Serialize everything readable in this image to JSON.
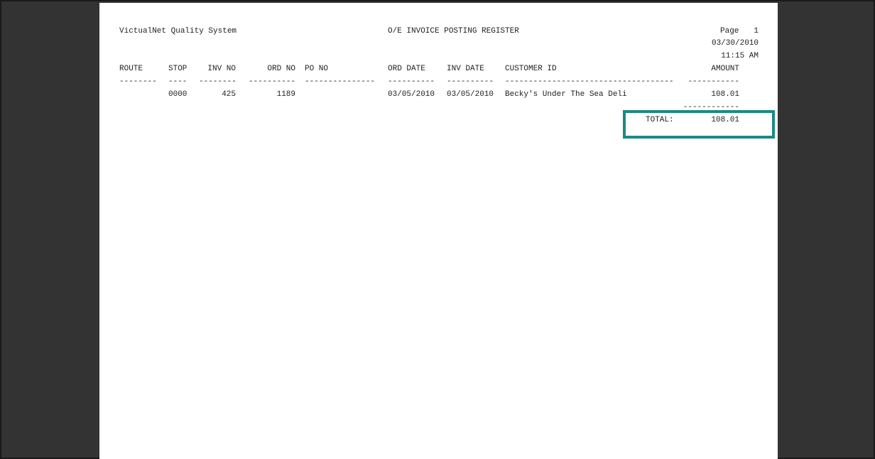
{
  "report": {
    "company": "VictualNet Quality System",
    "title": "O/E INVOICE POSTING REGISTER",
    "page_label": "Page",
    "page_number": "1",
    "date": "03/30/2010",
    "time": "11:15 AM"
  },
  "columns": {
    "route": "ROUTE",
    "stop": "STOP",
    "inv_no": "INV NO",
    "ord_no": "ORD NO",
    "po_no": "PO NO",
    "ord_date": "ORD DATE",
    "inv_date": "INV DATE",
    "customer_id": "CUSTOMER ID",
    "amount": "AMOUNT"
  },
  "separators": {
    "route": "--------",
    "stop": "----",
    "inv_no": "--------",
    "ord_no": "----------",
    "po_no": "---------------",
    "ord_date": "----------",
    "inv_date": "----------",
    "customer_id": "------------------------------------",
    "amount": "-----------",
    "total_rule": "------------"
  },
  "rows": [
    {
      "route": "",
      "stop": "0000",
      "inv_no": "425",
      "ord_no": "1189",
      "po_no": "",
      "ord_date": "03/05/2010",
      "inv_date": "03/05/2010",
      "customer_id": "Becky's Under The Sea Deli",
      "amount": "108.01"
    }
  ],
  "total": {
    "label": "TOTAL:",
    "value": "108.01"
  },
  "colors": {
    "highlight_border": "#1a8a86",
    "background": "#333333",
    "page": "#ffffff"
  }
}
